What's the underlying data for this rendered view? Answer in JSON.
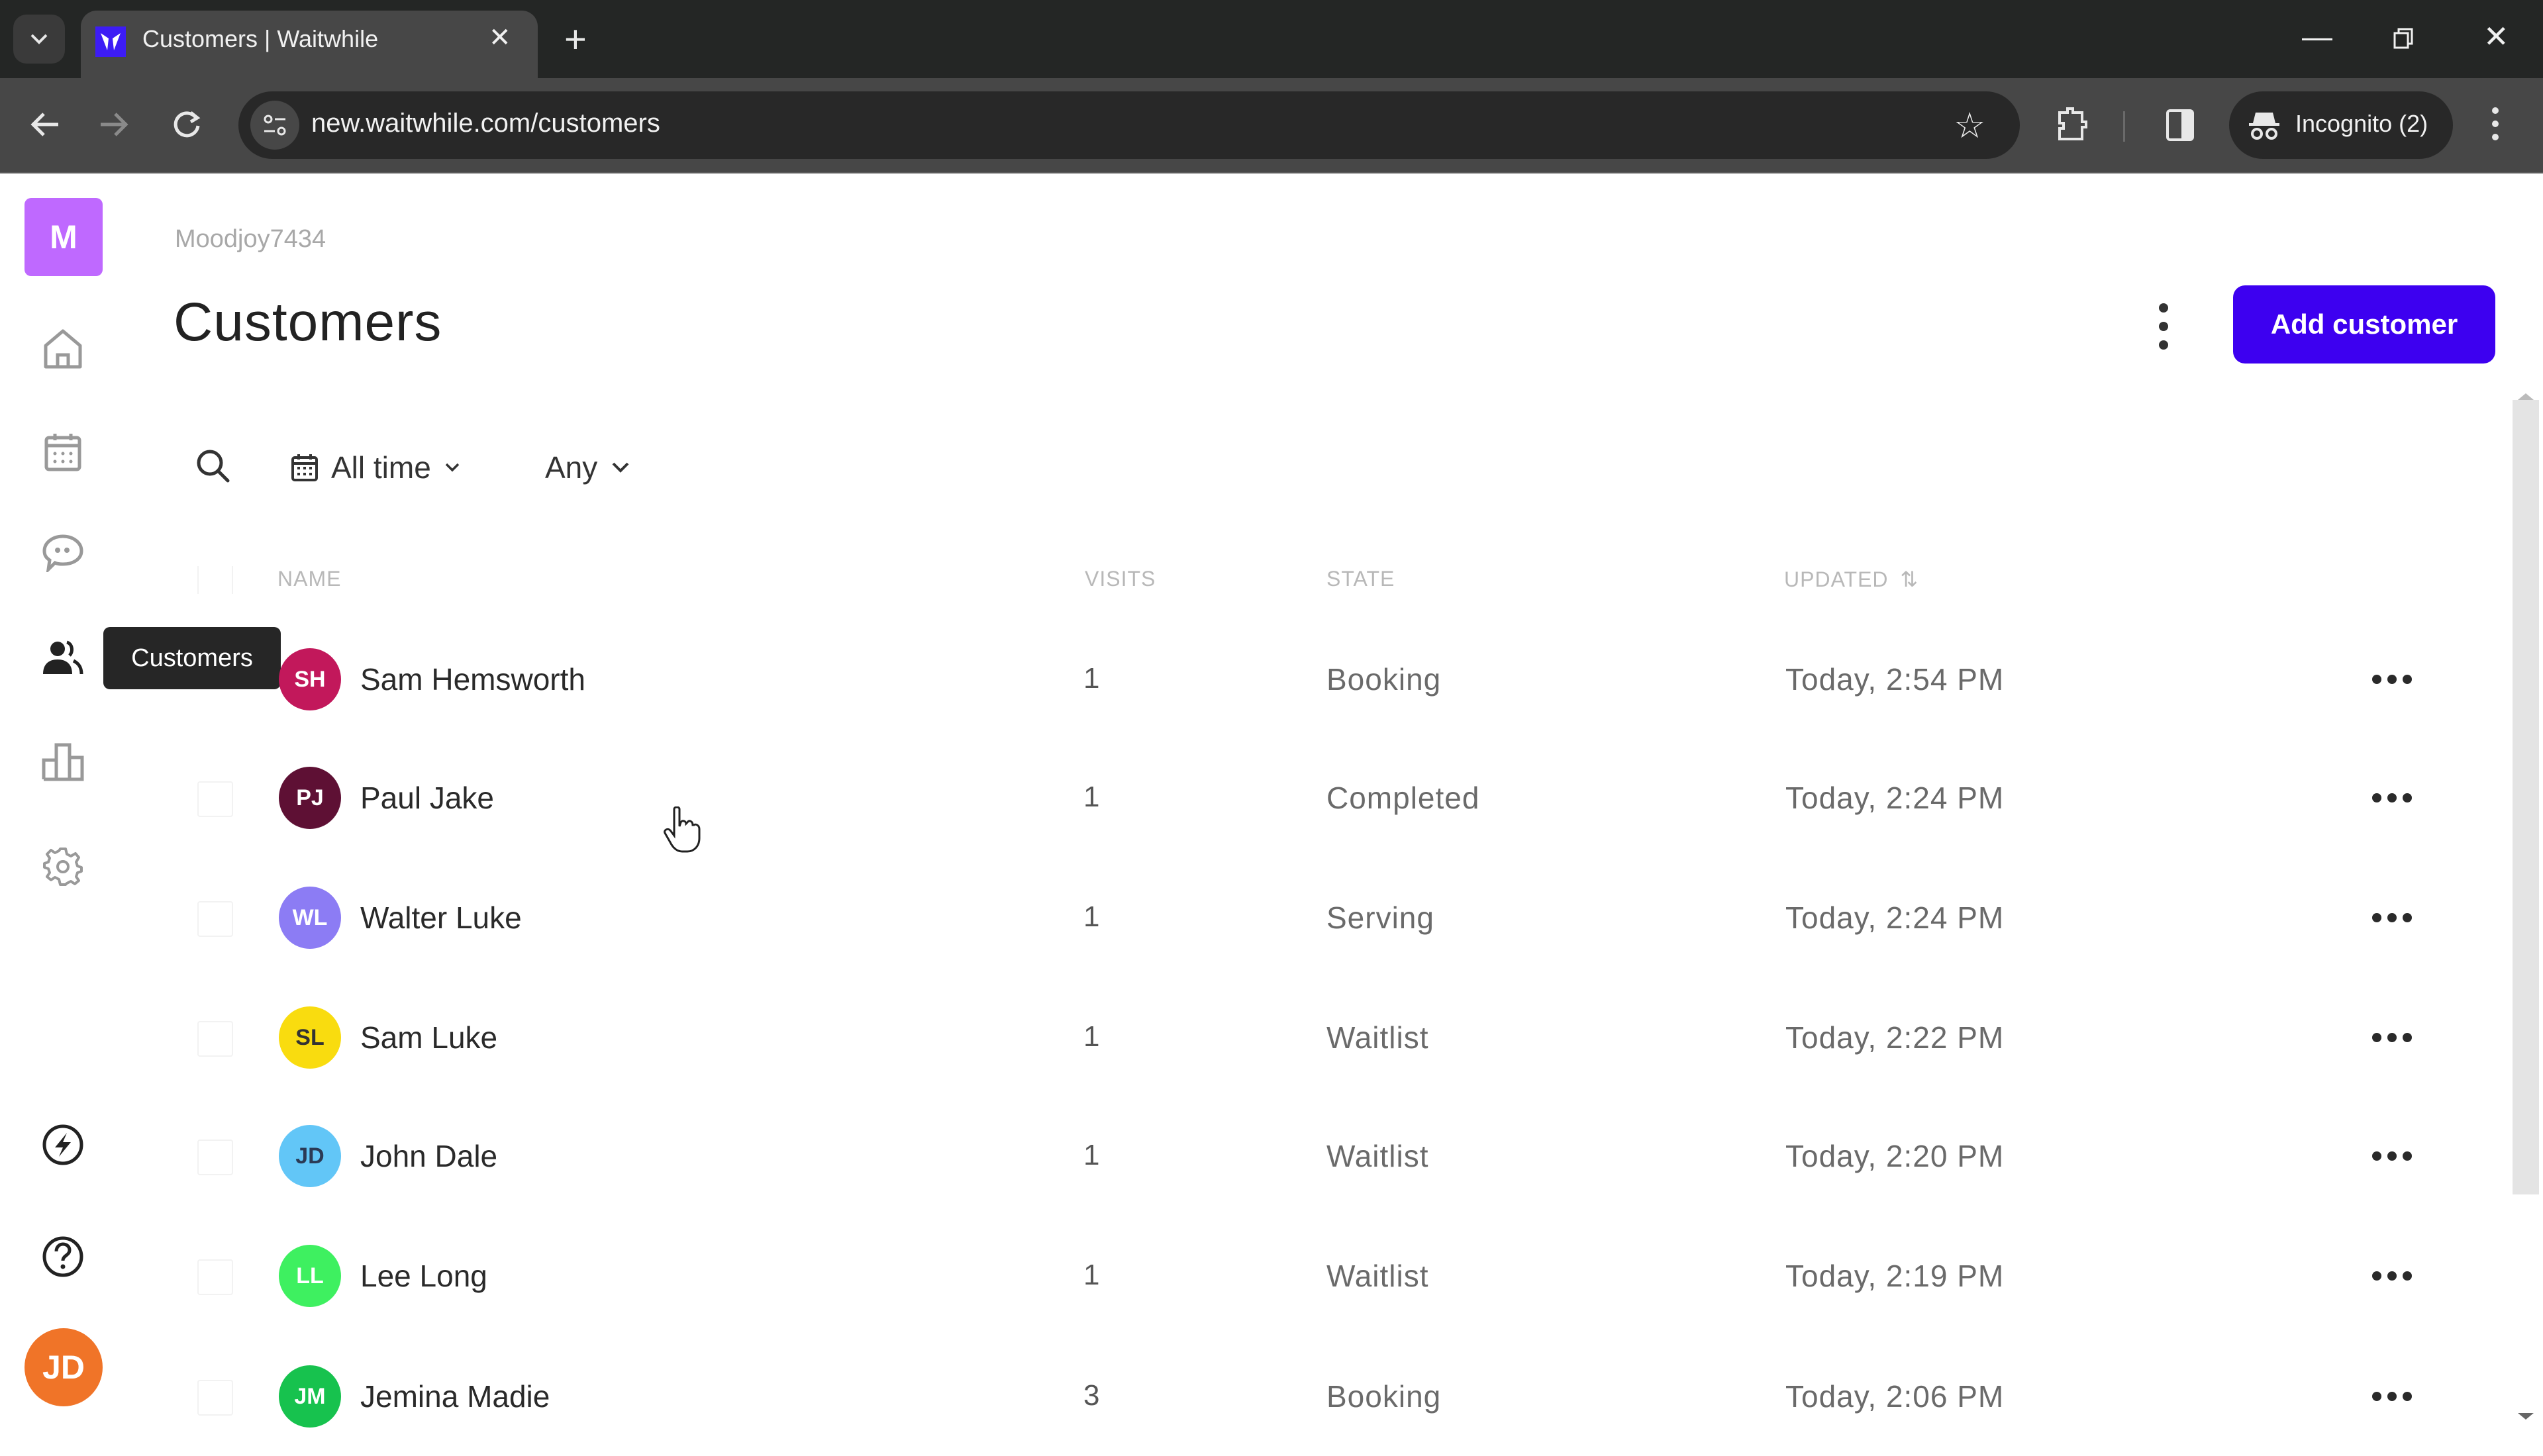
{
  "browser": {
    "tab_title": "Customers | Waitwhile",
    "url": "new.waitwhile.com/customers",
    "incognito_label": "Incognito (2)",
    "favicon_letter": "W",
    "icons": {
      "tab_list": "chevron-down-icon",
      "tab_close": "close-icon",
      "new_tab": "plus-icon",
      "minimize": "minimize-icon",
      "restore": "restore-icon",
      "window_close": "close-icon",
      "back": "arrow-left-icon",
      "forward": "arrow-right-icon",
      "reload": "reload-icon",
      "site_info": "tune-icon",
      "bookmark": "star-icon",
      "extensions": "puzzle-icon",
      "side_panel": "side-panel-icon",
      "incognito": "incognito-icon",
      "menu": "kebab-icon"
    }
  },
  "sidebar": {
    "logo_letter": "M",
    "logo_color": "#bf69ff",
    "items": [
      {
        "name": "home",
        "icon": "home-icon"
      },
      {
        "name": "calendar",
        "icon": "calendar-icon"
      },
      {
        "name": "messages",
        "icon": "chat-icon"
      },
      {
        "name": "customers",
        "icon": "users-icon",
        "active": true
      },
      {
        "name": "analytics",
        "icon": "bar-chart-icon"
      },
      {
        "name": "settings",
        "icon": "gear-icon"
      }
    ],
    "bottom_items": [
      {
        "name": "whats-new",
        "icon": "lightning-icon"
      },
      {
        "name": "help",
        "icon": "help-icon"
      }
    ],
    "tooltip": "Customers",
    "user_initials": "JD",
    "user_color": "#f07428"
  },
  "header": {
    "org_name": "Moodjoy7434",
    "title": "Customers",
    "add_button_label": "Add customer",
    "accent_color": "#3d00f0"
  },
  "filters": {
    "date_range": "All time",
    "state": "Any"
  },
  "table": {
    "columns": [
      "NAME",
      "VISITS",
      "STATE",
      "UPDATED"
    ],
    "sort_column": "UPDATED",
    "rows": [
      {
        "initials": "SH",
        "name": "Sam Hemsworth",
        "visits": "1",
        "state": "Booking",
        "updated": "Today, 2:54 PM",
        "color": "#c2185b",
        "text_color": "#ffffff"
      },
      {
        "initials": "PJ",
        "name": "Paul Jake",
        "visits": "1",
        "state": "Completed",
        "updated": "Today, 2:24 PM",
        "color": "#5e1034",
        "text_color": "#ffffff"
      },
      {
        "initials": "WL",
        "name": "Walter Luke",
        "visits": "1",
        "state": "Serving",
        "updated": "Today, 2:24 PM",
        "color": "#8c7cf4",
        "text_color": "#ffffff"
      },
      {
        "initials": "SL",
        "name": "Sam Luke",
        "visits": "1",
        "state": "Waitlist",
        "updated": "Today, 2:22 PM",
        "color": "#f9dc0f",
        "text_color": "#333333"
      },
      {
        "initials": "JD",
        "name": "John Dale",
        "visits": "1",
        "state": "Waitlist",
        "updated": "Today, 2:20 PM",
        "color": "#62c6f7",
        "text_color": "#2b3a55"
      },
      {
        "initials": "LL",
        "name": "Lee Long",
        "visits": "1",
        "state": "Waitlist",
        "updated": "Today, 2:19 PM",
        "color": "#3ef060",
        "text_color": "#ffffff"
      },
      {
        "initials": "JM",
        "name": "Jemina Madie",
        "visits": "3",
        "state": "Booking",
        "updated": "Today, 2:06 PM",
        "color": "#17c24e",
        "text_color": "#ffffff"
      }
    ]
  }
}
